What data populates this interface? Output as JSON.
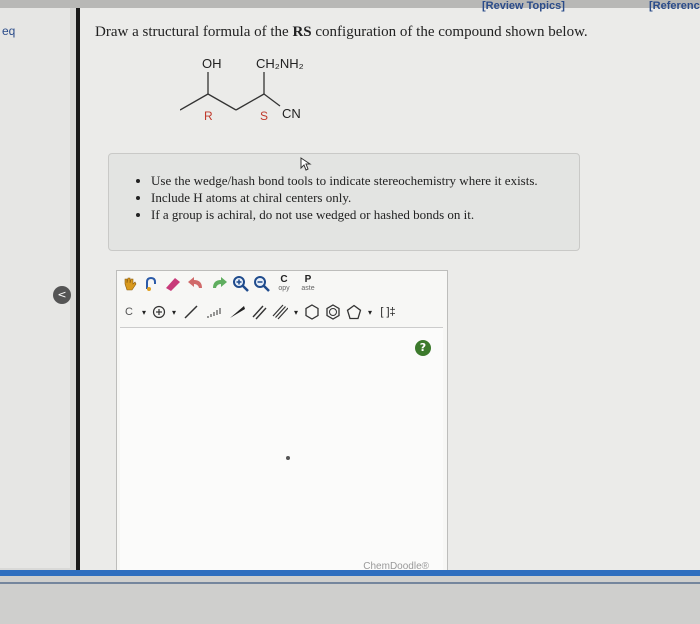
{
  "header": {
    "review_topics": "[Review Topics]",
    "references": "[Referenc"
  },
  "sidebar": {
    "eq_label": "eq",
    "collapse_glyph": "<"
  },
  "question": {
    "prefix": "Draw a structural formula of the ",
    "bold": "RS",
    "suffix": " configuration of the compound shown below."
  },
  "molecule": {
    "oh": "OH",
    "ch2nh2": "CH₂NH₂",
    "r_label": "R",
    "s_label": "S",
    "cn": "CN"
  },
  "hints": [
    "Use the wedge/hash bond tools to indicate stereochemistry where it exists.",
    "Include H atoms at chiral centers only.",
    "If a group is achiral, do not use wedged or hashed bonds on it."
  ],
  "toolbar": {
    "copy_top": "C",
    "copy_bottom": "opy",
    "paste_top": "P",
    "paste_bottom": "aste",
    "carbon_label": "C",
    "bracket_label": "[ ]‡"
  },
  "editor": {
    "help": "?",
    "brand": "ChemDoodle®"
  },
  "colors": {
    "link": "#2b4c8a",
    "accent_band": "#2f6fbf",
    "help_green": "#3c7a2c"
  }
}
